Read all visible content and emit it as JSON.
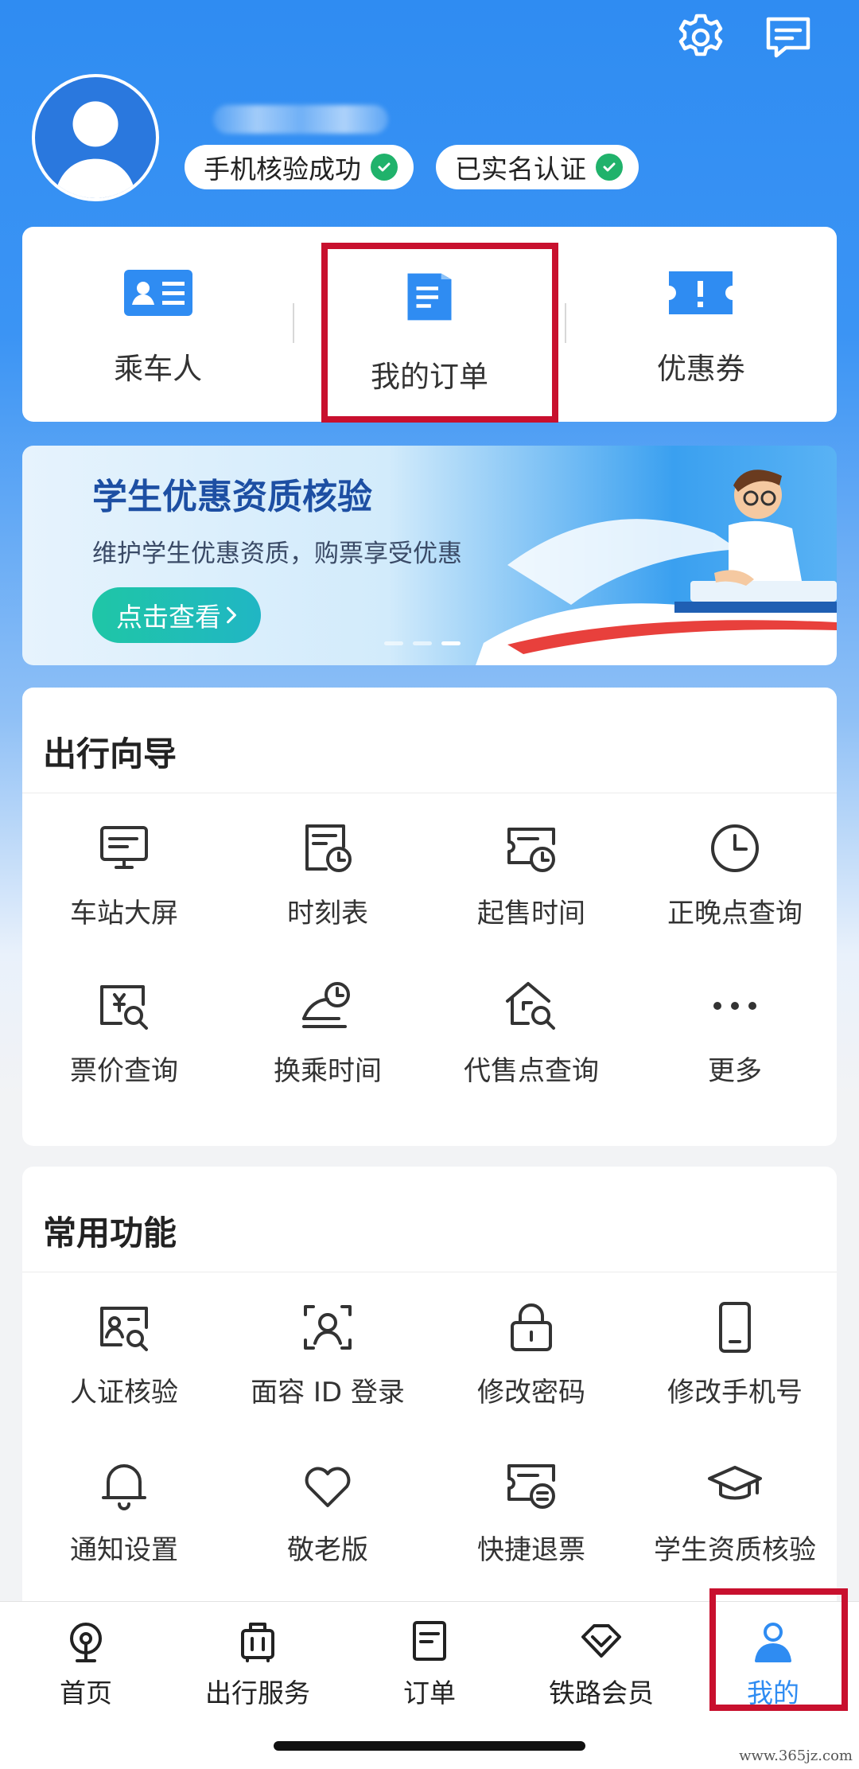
{
  "header": {
    "settings_icon": "gear-icon",
    "message_icon": "message-icon",
    "badges": [
      {
        "label": "手机核验成功"
      },
      {
        "label": "已实名认证"
      }
    ]
  },
  "quick_actions": [
    {
      "label": "乘车人",
      "icon": "id-card-icon"
    },
    {
      "label": "我的订单",
      "icon": "order-icon"
    },
    {
      "label": "优惠券",
      "icon": "coupon-icon"
    }
  ],
  "banner": {
    "title": "学生优惠资质核验",
    "subtitle": "维护学生优惠资质，购票享受优惠",
    "button": "点击查看"
  },
  "travel_guide": {
    "title": "出行向导",
    "items": [
      {
        "label": "车站大屏"
      },
      {
        "label": "时刻表"
      },
      {
        "label": "起售时间"
      },
      {
        "label": "正晚点查询"
      },
      {
        "label": "票价查询"
      },
      {
        "label": "换乘时间"
      },
      {
        "label": "代售点查询"
      },
      {
        "label": "更多"
      }
    ]
  },
  "common_functions": {
    "title": "常用功能",
    "items": [
      {
        "label": "人证核验"
      },
      {
        "label": "面容 ID 登录"
      },
      {
        "label": "修改密码"
      },
      {
        "label": "修改手机号"
      },
      {
        "label": "通知设置"
      },
      {
        "label": "敬老版"
      },
      {
        "label": "快捷退票"
      },
      {
        "label": "学生资质核验"
      }
    ]
  },
  "tabbar": [
    {
      "label": "首页"
    },
    {
      "label": "出行服务"
    },
    {
      "label": "订单"
    },
    {
      "label": "铁路会员"
    },
    {
      "label": "我的"
    }
  ],
  "colors": {
    "accent": "#2f8cf2",
    "highlight_box": "#c8102e",
    "success": "#20b26b"
  },
  "watermark": "www.365jz.com"
}
